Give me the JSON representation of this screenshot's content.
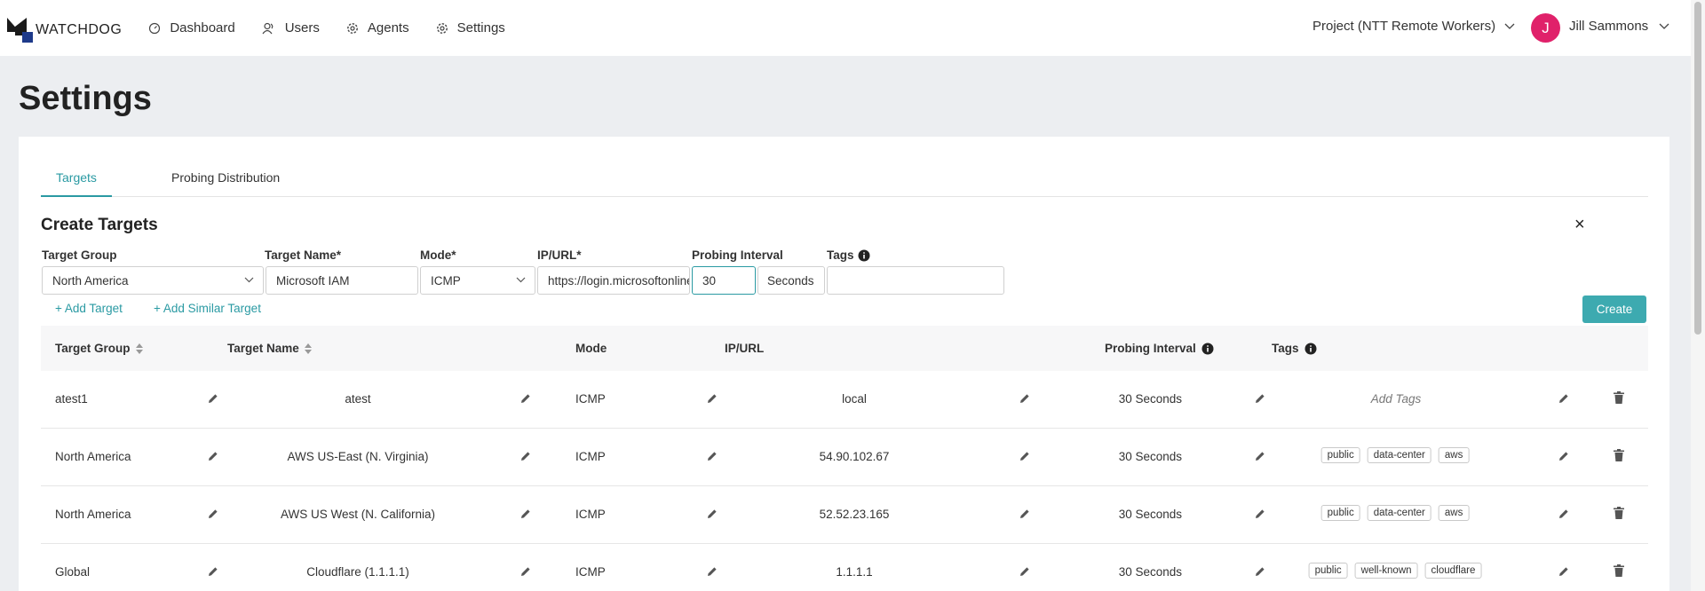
{
  "app": {
    "name": "WATCHDOG"
  },
  "nav": {
    "items": [
      {
        "label": "Dashboard",
        "icon": "dashboard-icon"
      },
      {
        "label": "Users",
        "icon": "users-icon"
      },
      {
        "label": "Agents",
        "icon": "gear-icon"
      },
      {
        "label": "Settings",
        "icon": "gear-icon"
      }
    ]
  },
  "header": {
    "project": "Project (NTT Remote Workers)",
    "user_initial": "J",
    "user_name": "Jill Sammons"
  },
  "page": {
    "title": "Settings"
  },
  "tabs": [
    {
      "label": "Targets",
      "active": true
    },
    {
      "label": "Probing Distribution",
      "active": false
    }
  ],
  "create": {
    "title": "Create Targets",
    "close": "×",
    "labels": {
      "group": "Target Group",
      "name": "Target Name*",
      "mode": "Mode*",
      "ip": "IP/URL*",
      "interval": "Probing Interval",
      "tags": "Tags"
    },
    "values": {
      "group": "North America",
      "name": "Microsoft IAM",
      "mode": "ICMP",
      "ip": "https://login.microsoftonline.com",
      "interval": "30",
      "interval_unit": "Seconds",
      "tags": ""
    },
    "add_target": "+ Add Target",
    "add_similar": "+ Add Similar Target",
    "create_button": "Create"
  },
  "table": {
    "headers": {
      "group": "Target Group",
      "name": "Target Name",
      "mode": "Mode",
      "ip": "IP/URL",
      "interval": "Probing Interval",
      "tags": "Tags"
    },
    "rows": [
      {
        "group": "atest1",
        "name": "atest",
        "mode": "ICMP",
        "ip": "local",
        "interval": "30 Seconds",
        "tags": [],
        "add_tags": "Add Tags"
      },
      {
        "group": "North America",
        "name": "AWS US-East (N. Virginia)",
        "mode": "ICMP",
        "ip": "54.90.102.67",
        "interval": "30 Seconds",
        "tags": [
          "public",
          "data-center",
          "aws"
        ]
      },
      {
        "group": "North America",
        "name": "AWS US West (N. California)",
        "mode": "ICMP",
        "ip": "52.52.23.165",
        "interval": "30 Seconds",
        "tags": [
          "public",
          "data-center",
          "aws"
        ]
      },
      {
        "group": "Global",
        "name": "Cloudflare (1.1.1.1)",
        "mode": "ICMP",
        "ip": "1.1.1.1",
        "interval": "30 Seconds",
        "tags": [
          "public",
          "well-known",
          "cloudflare"
        ]
      }
    ]
  },
  "colors": {
    "accent": "#2a9aa3",
    "button": "#3daab0",
    "avatar": "#e0216a"
  }
}
